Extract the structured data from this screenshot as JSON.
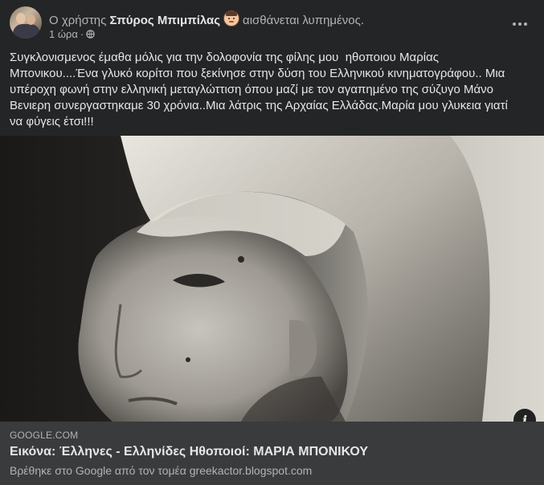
{
  "post": {
    "author_prefix": "Ο χρήστης",
    "author_name": "Σπύρος Μπιμπίλας",
    "feeling": "αισθάνεται λυπημένος.",
    "time": "1 ώρα",
    "separator": "·",
    "more_icon": "more-dots-icon",
    "privacy_icon": "globe-icon",
    "feeling_icon": "sad-face-emoji",
    "text": "Συγκλονισμενος έμαθα μόλις για την δολοφονία της φίλης μου  ηθοποιου Μαρίας\nΜπονικου....Ένα γλυκό κορίτσι που ξεκίνησε στην δύση του Ελληνικού κινηματογράφου.. Μια\nυπέροχη φωνή στην ελληνική μεταγλώττιση όπου μαζί με τον αγαπημένο της σύζυγο Μάνο\nΒενιερη συνεργαστηκαμε 30 χρόνια..Μια λάτρις της Αρχαίας Ελλάδας.Μαρία μου γλυκεια γιατί\nνα φύγεις έτσι!!!"
  },
  "link": {
    "domain": "GOOGLE.COM",
    "title": "Εικόνα: Έλληνες - Ελληνίδες Ηθοποιοί: ΜΑΡΙΑ ΜΠΟΝΙΚΟΥ",
    "subtitle": "Βρέθηκε στο Google από τον τομέα greekactor.blogspot.com",
    "info_icon": "info-icon",
    "info_label": "i"
  },
  "colors": {
    "background": "#242526",
    "link_box": "#3a3b3c",
    "primary_text": "#e4e6eb",
    "secondary_text": "#b0b3b8"
  }
}
